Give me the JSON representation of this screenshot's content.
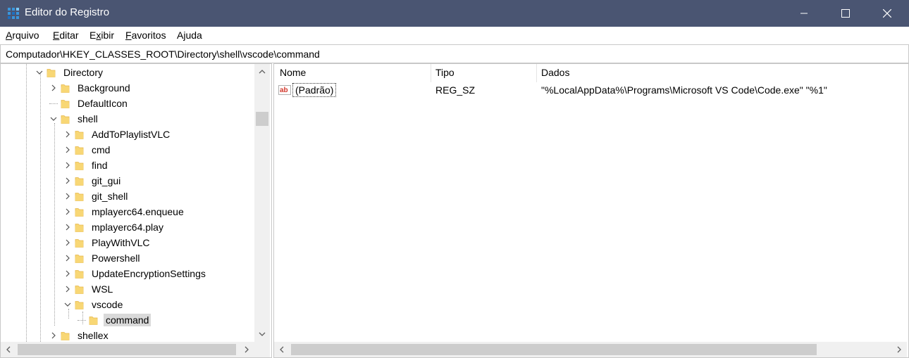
{
  "window": {
    "title": "Editor do Registro",
    "app_icon": "regedit-icon",
    "controls": [
      "minimize-icon",
      "maximize-icon",
      "close-icon"
    ],
    "titlebar_color": "#4a5572"
  },
  "menu": [
    {
      "label": "Arquivo",
      "key": "A",
      "rest": "rquivo"
    },
    {
      "label": "Editar",
      "key": "E",
      "rest": "ditar"
    },
    {
      "label": "Exibir",
      "key": "x",
      "pre": "E",
      "rest": "ibir"
    },
    {
      "label": "Favoritos",
      "key": "F",
      "rest": "avoritos"
    },
    {
      "label": "Ajuda",
      "key": "j",
      "pre": "A",
      "rest": "uda"
    }
  ],
  "address": "Computador\\HKEY_CLASSES_ROOT\\Directory\\shell\\vscode\\command",
  "tree": [
    {
      "label": "Directory",
      "expander": "expanded"
    },
    {
      "label": "Background",
      "expander": "collapsed"
    },
    {
      "label": "DefaultIcon",
      "expander": "none"
    },
    {
      "label": "shell",
      "expander": "expanded"
    },
    {
      "label": "AddToPlaylistVLC",
      "expander": "collapsed"
    },
    {
      "label": "cmd",
      "expander": "collapsed"
    },
    {
      "label": "find",
      "expander": "collapsed"
    },
    {
      "label": "git_gui",
      "expander": "collapsed"
    },
    {
      "label": "git_shell",
      "expander": "collapsed"
    },
    {
      "label": "mplayerc64.enqueue",
      "expander": "collapsed"
    },
    {
      "label": "mplayerc64.play",
      "expander": "collapsed"
    },
    {
      "label": "PlayWithVLC",
      "expander": "collapsed"
    },
    {
      "label": "Powershell",
      "expander": "collapsed"
    },
    {
      "label": "UpdateEncryptionSettings",
      "expander": "collapsed"
    },
    {
      "label": "WSL",
      "expander": "collapsed"
    },
    {
      "label": "vscode",
      "expander": "expanded"
    },
    {
      "label": "command",
      "expander": "none",
      "selected": true
    },
    {
      "label": "shellex",
      "expander": "collapsed"
    }
  ],
  "columns": {
    "name": "Nome",
    "type": "Tipo",
    "data": "Dados"
  },
  "values": [
    {
      "name": "(Padrão)",
      "type": "REG_SZ",
      "data": "\"%LocalAppData%\\Programs\\Microsoft VS Code\\Code.exe\" \"%1\"",
      "icon": "string-value-icon"
    }
  ],
  "colors": {
    "folder": "#f8d775",
    "folder_dark": "#e6b84a",
    "selection": "#d9d9d9"
  }
}
